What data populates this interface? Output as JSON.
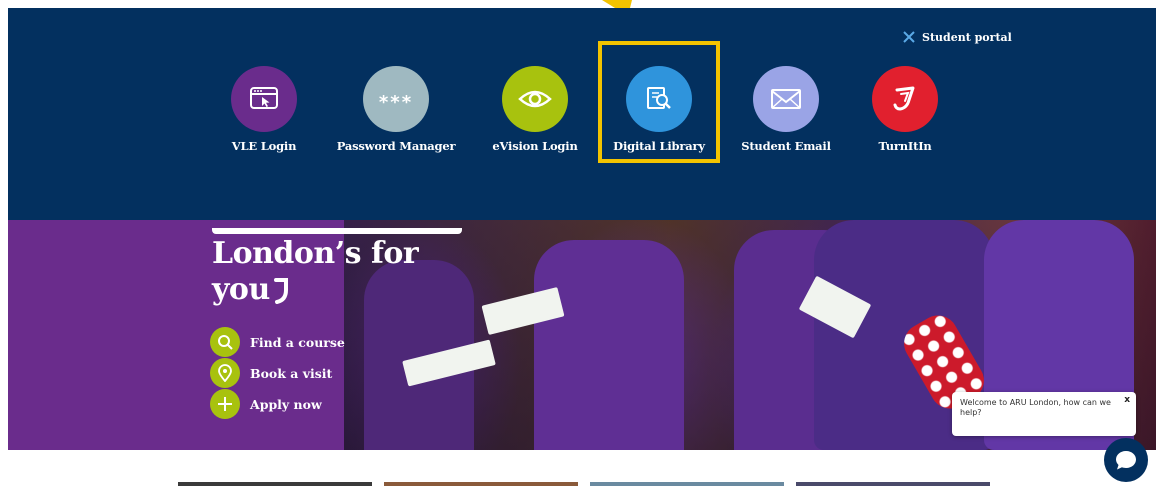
{
  "annotation": {
    "pointer_color": "#f3c300"
  },
  "portal": {
    "close_label": "Student portal",
    "highlight_color": "#f3c300",
    "tiles": [
      {
        "label": "VLE Login",
        "icon": "browser-cursor-icon",
        "color": "#6a2c8c"
      },
      {
        "label": "Password Manager",
        "icon": "password-asterisks-icon",
        "color": "#9fb9c1",
        "icon_text": "***"
      },
      {
        "label": "eVision Login",
        "icon": "eye-icon",
        "color": "#a8c20e"
      },
      {
        "label": "Digital Library",
        "icon": "book-search-icon",
        "color": "#2f94dc"
      },
      {
        "label": "Student Email",
        "icon": "envelope-icon",
        "color": "#9aa4e6"
      },
      {
        "label": "TurnItIn",
        "icon": "turnitin-logo-icon",
        "color": "#e1202e"
      }
    ]
  },
  "hero": {
    "headline_line1": "London’s for",
    "headline_line2": "you",
    "ctas": [
      {
        "label": "Find a course",
        "icon": "search-icon"
      },
      {
        "label": "Book a visit",
        "icon": "location-pin-icon"
      },
      {
        "label": "Apply now",
        "icon": "plus-icon"
      }
    ]
  },
  "chat": {
    "message": "Welcome to ARU London, how can we help?",
    "close_label": "x",
    "launcher_icon": "chat-bubble-icon"
  }
}
